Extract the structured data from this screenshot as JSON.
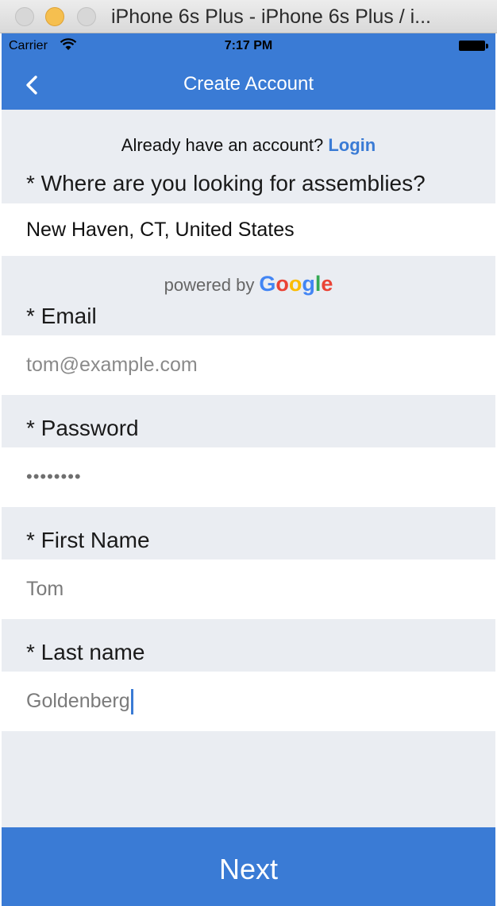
{
  "window": {
    "title": "iPhone 6s Plus - iPhone 6s Plus / i..."
  },
  "status_bar": {
    "carrier": "Carrier",
    "time": "7:17 PM"
  },
  "nav": {
    "title": "Create Account"
  },
  "login_prompt": {
    "text": "Already have an account?",
    "link": "Login"
  },
  "location": {
    "label": "* Where are you looking for assemblies?",
    "value": "New Haven, CT, United States"
  },
  "attribution": {
    "text": "powered by",
    "google_letters": [
      "G",
      "o",
      "o",
      "g",
      "l",
      "e"
    ]
  },
  "email": {
    "label": "* Email",
    "placeholder": "tom@example.com"
  },
  "password": {
    "label": "* Password",
    "masked_value": "••••••••"
  },
  "first_name": {
    "label": "* First Name",
    "value": "Tom"
  },
  "last_name": {
    "label": "* Last name",
    "value": "Goldenberg"
  },
  "actions": {
    "next": "Next"
  },
  "colors": {
    "accent": "#3a7bd5",
    "background": "#eaedf2",
    "field": "#ffffff"
  },
  "icons": [
    "back-chevron-icon",
    "wifi-icon",
    "battery-icon"
  ]
}
